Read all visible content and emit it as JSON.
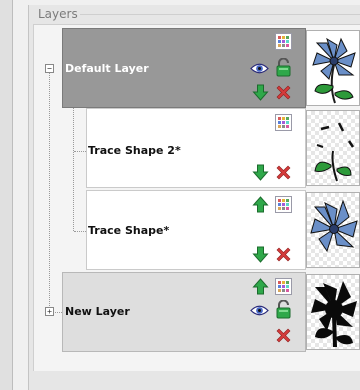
{
  "panel": {
    "title": "Layers"
  },
  "layers": [
    {
      "name": "Default Layer",
      "type": "group",
      "expanded": true
    },
    {
      "name": "Trace Shape 2*",
      "type": "shape"
    },
    {
      "name": "Trace Shape*",
      "type": "shape"
    },
    {
      "name": "New Layer",
      "type": "group",
      "expanded": false
    }
  ],
  "icons": {
    "properties": "grid-properties-icon",
    "visibility": "eye-icon",
    "lock": "padlock-icon",
    "move_up": "green-up-arrow-icon",
    "move_down": "green-down-arrow-icon",
    "delete": "red-x-icon"
  },
  "colors": {
    "group_selected_bg": "#989898",
    "group_bg": "#dedede",
    "shape_bg": "#ffffff",
    "arrow_green": "#2fa84a",
    "delete_red": "#d43b3b",
    "flower_blue": "#6a8fc8"
  }
}
